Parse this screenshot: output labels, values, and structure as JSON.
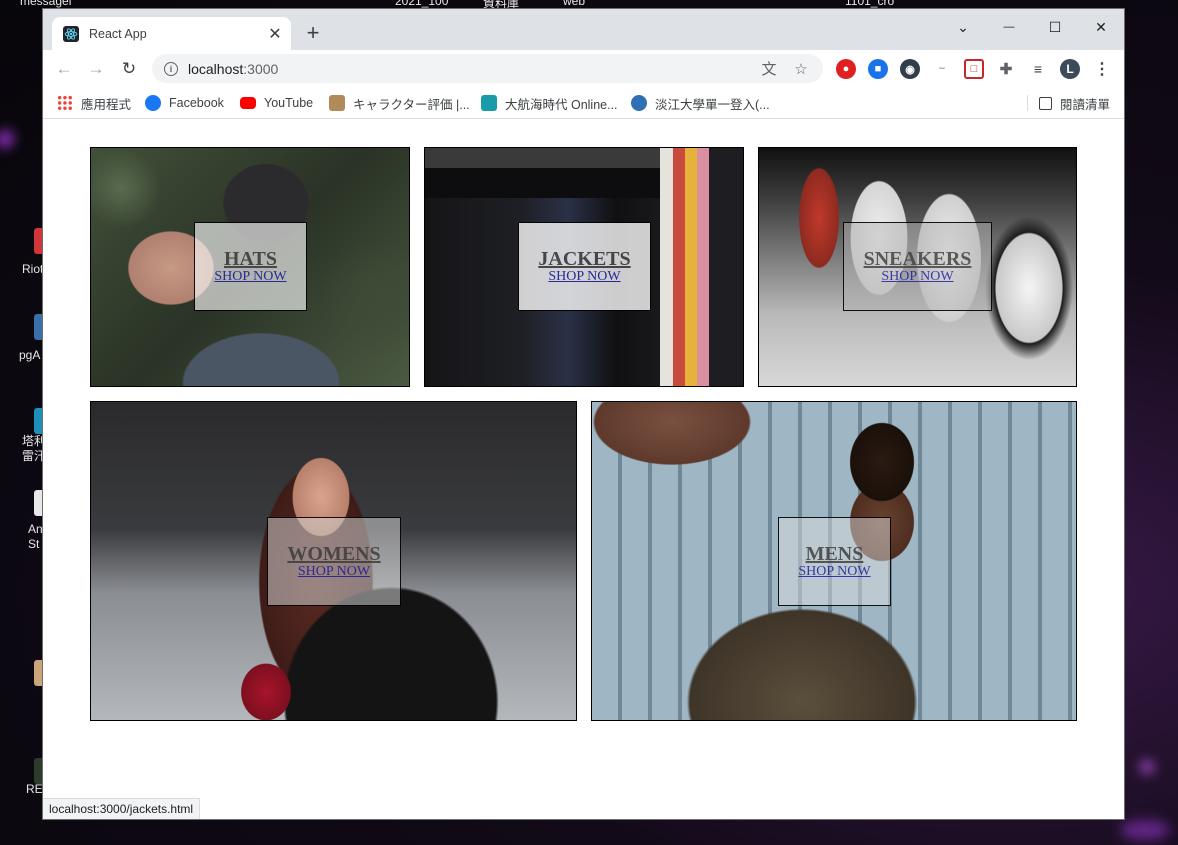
{
  "desktop": {
    "top_texts": [
      "messagel",
      "2021_100",
      "資料庫",
      "web",
      "1101_cro"
    ],
    "left_labels": [
      "Riot",
      "pgA",
      "塔利\n雷汗",
      "Ani\nSt",
      "RE"
    ]
  },
  "window": {
    "tab": {
      "title": "React App"
    },
    "controls": {
      "dropdown": "⌄",
      "minimize": "—",
      "maximize": "☐",
      "close": "✕"
    }
  },
  "toolbar": {
    "url_host": "localhost",
    "url_port": ":3000",
    "profile_initial": "L"
  },
  "bookmarks": [
    {
      "label": "應用程式",
      "color": "#ea4335"
    },
    {
      "label": "Facebook",
      "color": "#1877f2"
    },
    {
      "label": "YouTube",
      "color": "#ff0000"
    },
    {
      "label": "キャラクター評価 |...",
      "color": "#b08a5a"
    },
    {
      "label": "大航海時代 Online...",
      "color": "#1a9ca8"
    },
    {
      "label": "淡江大學單一登入(...",
      "color": "#2f6fb5"
    }
  ],
  "reading_list": "閱讀清單",
  "categories": [
    {
      "title": "HATS",
      "subtitle": "SHOP NOW"
    },
    {
      "title": "JACKETS",
      "subtitle": "SHOP NOW"
    },
    {
      "title": "SNEAKERS",
      "subtitle": "SHOP NOW"
    },
    {
      "title": "WOMENS",
      "subtitle": "SHOP NOW"
    },
    {
      "title": "MENS",
      "subtitle": "SHOP NOW"
    }
  ],
  "status_url": "localhost:3000/jackets.html"
}
